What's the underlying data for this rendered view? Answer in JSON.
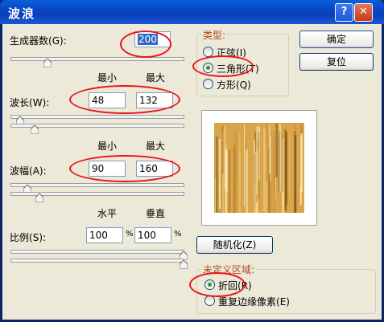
{
  "window": {
    "title": "波浪",
    "help_glyph": "?",
    "close_glyph": "✕"
  },
  "generators": {
    "label": "生成器数",
    "hotkey": "(G)",
    "colon": ":",
    "value": "200",
    "slider_fraction": 0.21
  },
  "wavelength": {
    "col_min": "最小",
    "col_max": "最大",
    "label": "波长",
    "hotkey": "(W)",
    "colon": ":",
    "min_value": "48",
    "max_value": "132",
    "min_slider_fraction": 0.05,
    "max_slider_fraction": 0.13
  },
  "amplitude": {
    "col_min": "最小",
    "col_max": "最大",
    "label": "波幅",
    "hotkey": "(A)",
    "colon": ":",
    "min_value": "90",
    "max_value": "160",
    "min_slider_fraction": 0.09,
    "max_slider_fraction": 0.16
  },
  "scale": {
    "col_h": "水平",
    "col_v": "垂直",
    "label": "比例",
    "hotkey": "(S)",
    "colon": ":",
    "h_value": "100",
    "v_value": "100",
    "percent": "%",
    "h_slider_fraction": 1.0,
    "v_slider_fraction": 1.0
  },
  "type_group": {
    "legend": "类型:",
    "options": [
      {
        "label": "正弦",
        "hotkey": "(I)",
        "selected": false
      },
      {
        "label": "三角形",
        "hotkey": "(T)",
        "selected": true
      },
      {
        "label": "方形",
        "hotkey": "(Q)",
        "selected": false
      }
    ]
  },
  "buttons": {
    "ok": "确定",
    "reset": "复位",
    "randomize": "随机化",
    "randomize_hotkey": "(Z)"
  },
  "undefined_group": {
    "legend": "未定义区域:",
    "options": [
      {
        "label": "折回",
        "hotkey": "(R)",
        "selected": true
      },
      {
        "label": "重复边缘像素",
        "hotkey": "(E)",
        "selected": false
      }
    ]
  },
  "colors": {
    "annotation": "#e8141c",
    "legend_text": "#b5471d",
    "title_bar": "#0846c8"
  }
}
